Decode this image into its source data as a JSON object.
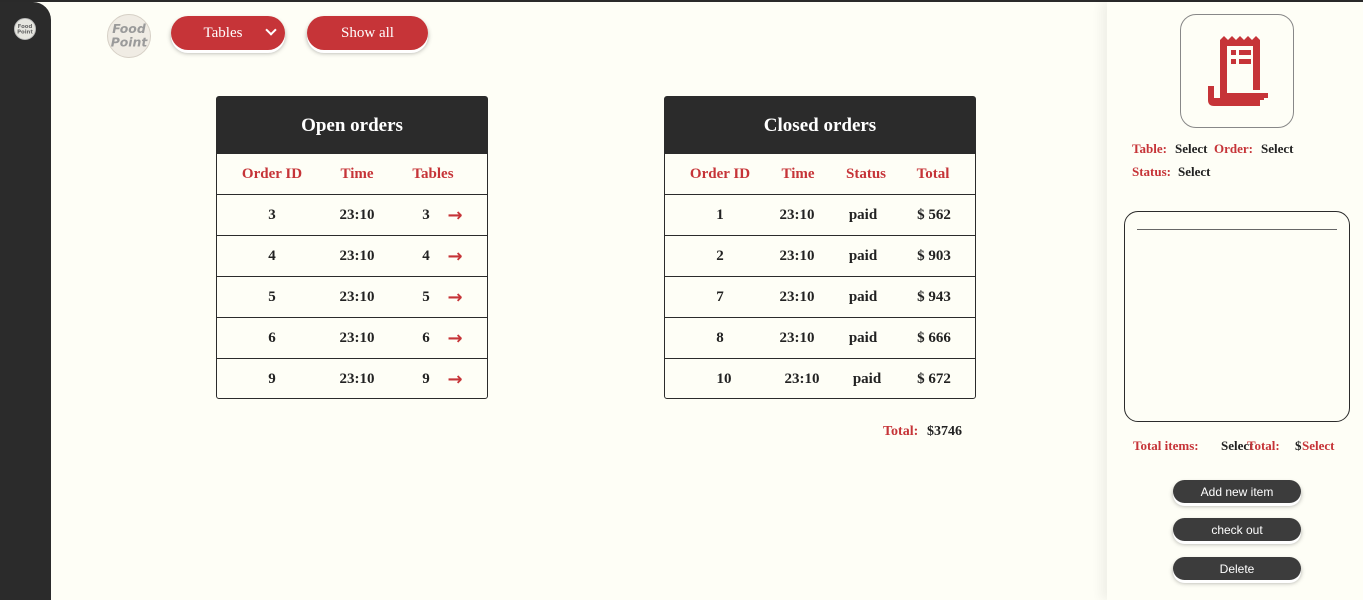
{
  "toolbar": {
    "tables_select": "Tables",
    "show_all": "Show all"
  },
  "open_orders": {
    "title": "Open orders",
    "headers": [
      "Order ID",
      "Time",
      "Tables"
    ],
    "rows": [
      {
        "id": "3",
        "time": "23:10",
        "table": "3"
      },
      {
        "id": "4",
        "time": "23:10",
        "table": "4"
      },
      {
        "id": "5",
        "time": "23:10",
        "table": "5"
      },
      {
        "id": "6",
        "time": "23:10",
        "table": "6"
      },
      {
        "id": "9",
        "time": "23:10",
        "table": "9"
      }
    ]
  },
  "closed_orders": {
    "title": "Closed orders",
    "headers": [
      "Order ID",
      "Time",
      "Status",
      "Total"
    ],
    "rows": [
      {
        "id": "1",
        "time": "23:10",
        "status": "paid",
        "total": "$ 562"
      },
      {
        "id": "2",
        "time": "23:10",
        "status": "paid",
        "total": "$ 903"
      },
      {
        "id": "7",
        "time": "23:10",
        "status": "paid",
        "total": "$ 943"
      },
      {
        "id": "8",
        "time": "23:10",
        "status": "paid",
        "total": "$ 666"
      },
      {
        "id": "10",
        "time": "23:10",
        "status": "paid",
        "total": "$ 672"
      }
    ],
    "total_label": "Total:",
    "total_value": "$3746"
  },
  "sidebar": {
    "table_label": "Table:",
    "table_value": "Select",
    "order_label": "Order:",
    "order_value": "Select",
    "status_label": "Status:",
    "status_value": "Select",
    "total_items_label": "Total items:",
    "total_items_value": "Select",
    "total_label": "Total:",
    "total_currency": "$",
    "total_value": "Select",
    "add_button": "Add new item",
    "checkout_button": "check out",
    "delete_button": "Delete"
  },
  "colors": {
    "accent": "#c63438",
    "dark": "#2b2b2b",
    "background": "#fefef6"
  },
  "icons": {
    "arrow": "→",
    "receipt": "receipt-icon",
    "logo": "food-point-logo"
  },
  "logo_text": [
    "Food",
    "Point"
  ]
}
